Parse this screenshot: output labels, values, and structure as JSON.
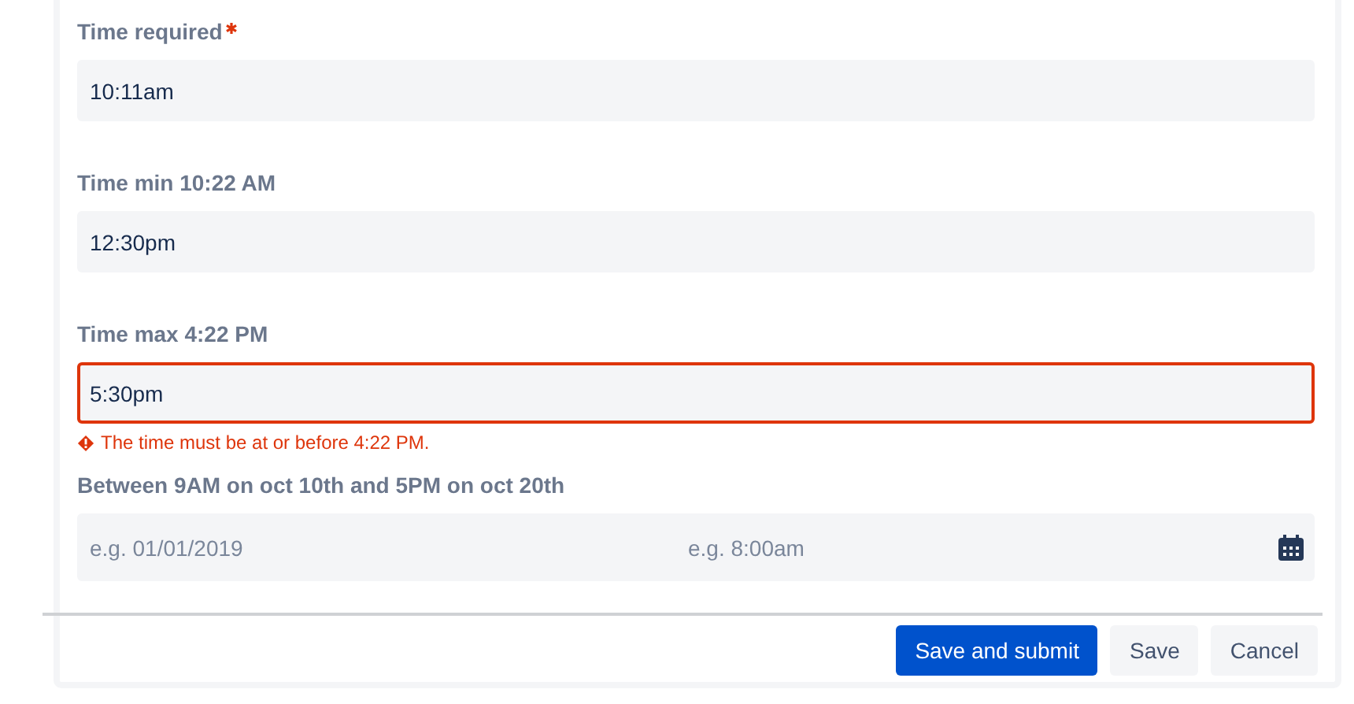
{
  "fields": [
    {
      "kind": "text",
      "label": "Time required",
      "required": true,
      "value": "10:11am",
      "invalid": false
    },
    {
      "kind": "text",
      "label": "Time min 10:22 AM",
      "required": false,
      "value": "12:30pm",
      "invalid": false
    },
    {
      "kind": "text",
      "label": "Time max 4:22 PM",
      "required": false,
      "value": "5:30pm",
      "invalid": true,
      "error": "The time must be at or before 4:22 PM."
    },
    {
      "kind": "datetime",
      "label": "Between 9AM on oct 10th and 5PM on oct 20th",
      "required": false,
      "date_placeholder": "e.g. 01/01/2019",
      "time_placeholder": "e.g. 8:00am",
      "invalid": false
    }
  ],
  "buttons": [
    {
      "kind": "primary",
      "label": "Save and submit"
    },
    {
      "kind": "subtle",
      "label": "Save"
    },
    {
      "kind": "subtle",
      "label": "Cancel"
    }
  ]
}
